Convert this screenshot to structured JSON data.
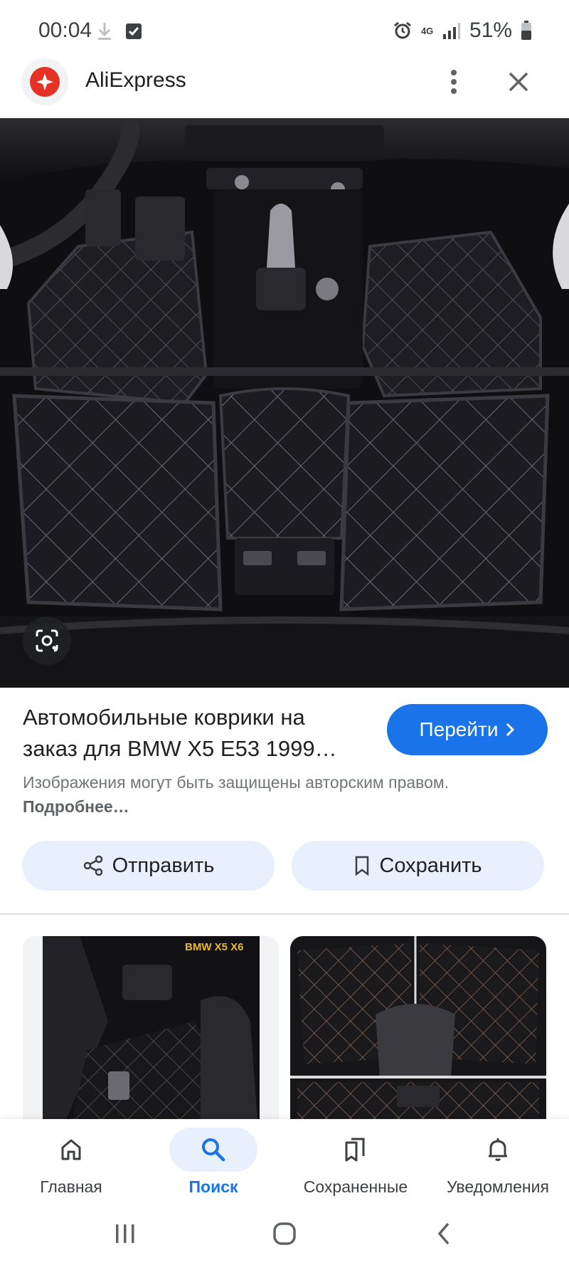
{
  "status_bar": {
    "time": "00:04",
    "battery": "51%",
    "network": "4G"
  },
  "header": {
    "app_name": "AliExpress",
    "logo_color": "#e43225"
  },
  "result": {
    "title_line1": "Автомобильные коврики на",
    "title_line2": "заказ для BMW X5 E53 1999…",
    "visit_label": "Перейти",
    "copyright_text": "Изображения могут быть защищены авторским правом.",
    "copyright_more": "Подробнее…"
  },
  "actions": {
    "share_label": "Отправить",
    "save_label": "Сохранить"
  },
  "thumbnails": {
    "left_badge": "BMW X5 X6"
  },
  "bottom_nav": {
    "items": [
      {
        "label": "Главная",
        "icon": "home-icon"
      },
      {
        "label": "Поиск",
        "icon": "search-icon",
        "active": true
      },
      {
        "label": "Сохраненные",
        "icon": "bookmarks-icon"
      },
      {
        "label": "Уведомления",
        "icon": "bell-icon"
      }
    ]
  },
  "colors": {
    "accent": "#1a73e8",
    "chip_bg": "#e8f0fe"
  }
}
